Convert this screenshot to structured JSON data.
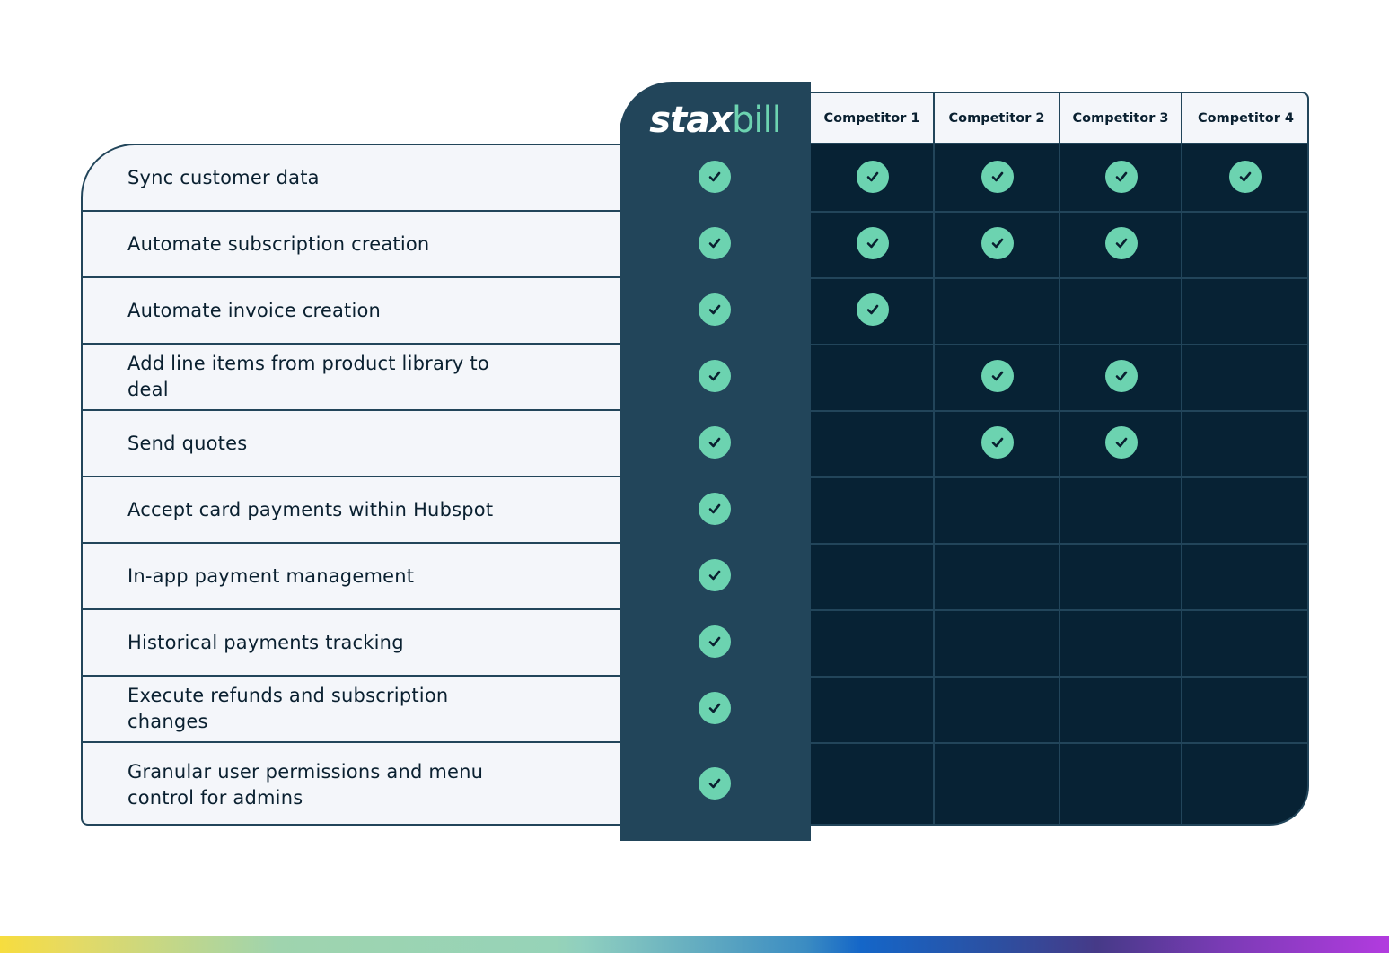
{
  "brand": {
    "logo_part1": "stax",
    "logo_part2": "bill",
    "accent_color": "#6cd3b0"
  },
  "competitors": [
    "Competitor 1",
    "Competitor 2",
    "Competitor 3",
    "Competitor 4"
  ],
  "features": [
    {
      "label": "Sync customer data",
      "staxbill": true,
      "competitors": [
        true,
        true,
        true,
        true
      ]
    },
    {
      "label": "Automate subscription creation",
      "staxbill": true,
      "competitors": [
        true,
        true,
        true,
        false
      ]
    },
    {
      "label": "Automate invoice creation",
      "staxbill": true,
      "competitors": [
        true,
        false,
        false,
        false
      ]
    },
    {
      "label": "Add line items from product library to deal",
      "staxbill": true,
      "competitors": [
        false,
        true,
        true,
        false
      ]
    },
    {
      "label": "Send quotes",
      "staxbill": true,
      "competitors": [
        false,
        true,
        true,
        false
      ]
    },
    {
      "label": "Accept card payments within Hubspot",
      "staxbill": true,
      "competitors": [
        false,
        false,
        false,
        false
      ]
    },
    {
      "label": "In-app payment management",
      "staxbill": true,
      "competitors": [
        false,
        false,
        false,
        false
      ]
    },
    {
      "label": "Historical payments tracking",
      "staxbill": true,
      "competitors": [
        false,
        false,
        false,
        false
      ]
    },
    {
      "label": "Execute refunds and subscription changes",
      "staxbill": true,
      "competitors": [
        false,
        false,
        false,
        false
      ]
    },
    {
      "label": "Granular user permissions and menu control for admins",
      "staxbill": true,
      "competitors": [
        false,
        false,
        false,
        false
      ]
    }
  ],
  "icons": {
    "check": "check-circle-icon"
  }
}
